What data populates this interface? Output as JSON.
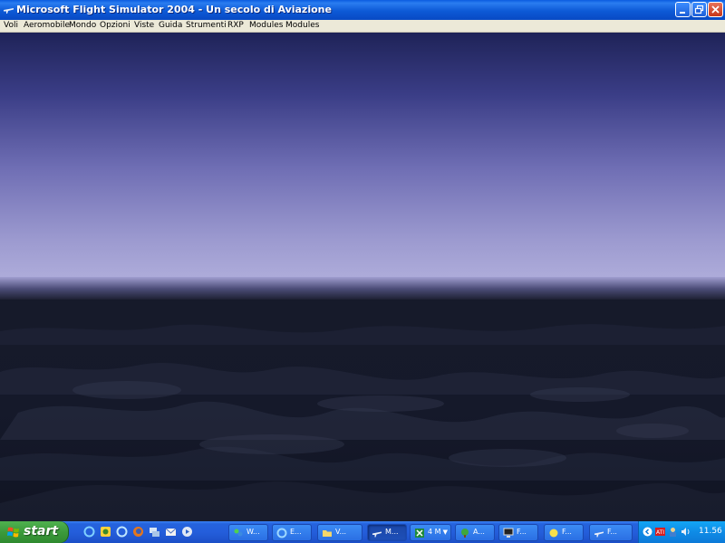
{
  "window": {
    "title": "Microsoft Flight Simulator 2004 - Un secolo di Aviazione",
    "controls": [
      "minimize",
      "restore",
      "close"
    ]
  },
  "menu": {
    "items": [
      "Voli",
      "Aeromobile",
      "Mondo",
      "Opzioni",
      "Viste",
      "Guida",
      "Strumenti",
      "RXP",
      "Modules",
      "Modules"
    ]
  },
  "scene": {
    "description_colors": {
      "sky_top": "#232860",
      "sky_horizon": "#a8a6d6",
      "ground": "#141826"
    }
  },
  "taskbar": {
    "start_label": "start",
    "quick_launch": [
      "ie-icon",
      "app-icon",
      "ie-icon",
      "firefox-icon",
      "network-icon",
      "mail-icon",
      "media-icon"
    ],
    "tasks": [
      {
        "label": "W...",
        "icon": "messenger-icon",
        "active": false
      },
      {
        "label": "E...",
        "icon": "ie-icon",
        "active": false
      },
      {
        "label": "V...",
        "icon": "folder-icon",
        "active": false
      },
      {
        "label": "M...",
        "icon": "plane-icon",
        "active": true
      },
      {
        "label": "4 M",
        "icon": "excel-icon",
        "active": false
      },
      {
        "label": "A...",
        "icon": "tree-icon",
        "active": false
      },
      {
        "label": "F...",
        "icon": "monitor-icon",
        "active": false
      },
      {
        "label": "F...",
        "icon": "sun-icon",
        "active": false
      },
      {
        "label": "F...",
        "icon": "plane-icon",
        "active": false
      }
    ],
    "clock": "11.56"
  }
}
